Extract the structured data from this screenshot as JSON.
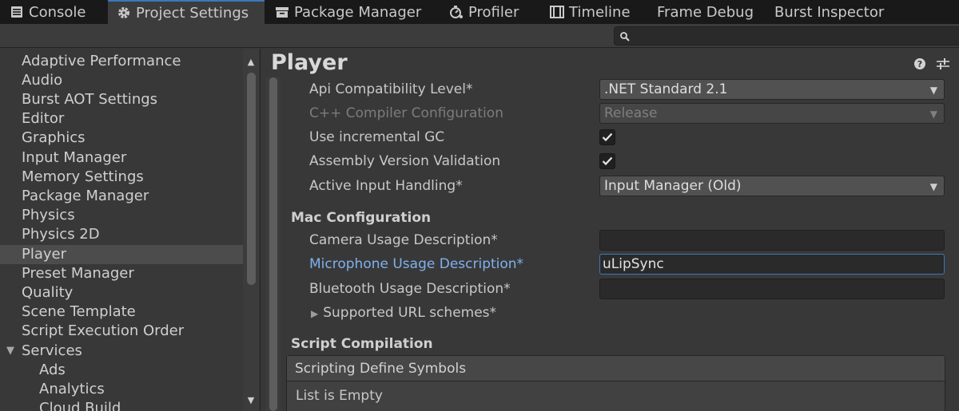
{
  "tabs": [
    {
      "label": "Console",
      "icon": "console-icon"
    },
    {
      "label": "Project Settings",
      "icon": "gear-icon"
    },
    {
      "label": "Package Manager",
      "icon": "package-icon"
    },
    {
      "label": "Profiler",
      "icon": "profiler-icon"
    },
    {
      "label": "Timeline",
      "icon": "timeline-icon"
    },
    {
      "label": "Frame Debug",
      "icon": ""
    },
    {
      "label": "Burst Inspector",
      "icon": ""
    }
  ],
  "active_tab": "Project Settings",
  "search": {
    "value": "",
    "placeholder": ""
  },
  "sidebar": {
    "items": [
      {
        "label": "Adaptive Performance"
      },
      {
        "label": "Audio"
      },
      {
        "label": "Burst AOT Settings"
      },
      {
        "label": "Editor"
      },
      {
        "label": "Graphics"
      },
      {
        "label": "Input Manager"
      },
      {
        "label": "Memory Settings"
      },
      {
        "label": "Package Manager"
      },
      {
        "label": "Physics"
      },
      {
        "label": "Physics 2D"
      },
      {
        "label": "Player"
      },
      {
        "label": "Preset Manager"
      },
      {
        "label": "Quality"
      },
      {
        "label": "Scene Template"
      },
      {
        "label": "Script Execution Order"
      },
      {
        "label": "Services"
      },
      {
        "label": "Ads"
      },
      {
        "label": "Analytics"
      },
      {
        "label": "Cloud Build"
      }
    ],
    "selected": "Player"
  },
  "main": {
    "title": "Player",
    "api_compat": {
      "label": "Api Compatibility Level*",
      "value": ".NET Standard 2.1"
    },
    "cpp_compiler": {
      "label": "C++ Compiler Configuration",
      "value": "Release"
    },
    "incremental_gc": {
      "label": "Use incremental GC",
      "checked": true
    },
    "assembly_validation": {
      "label": "Assembly Version Validation",
      "checked": true
    },
    "input_handling": {
      "label": "Active Input Handling*",
      "value": "Input Manager (Old)"
    },
    "mac_section": "Mac Configuration",
    "camera_desc": {
      "label": "Camera Usage Description*",
      "value": ""
    },
    "mic_desc": {
      "label": "Microphone Usage Description*",
      "value": "uLipSync"
    },
    "bluetooth_desc": {
      "label": "Bluetooth Usage Description*",
      "value": ""
    },
    "url_schemes": {
      "label": "Supported URL schemes*"
    },
    "script_section": "Script Compilation",
    "define_symbols": {
      "header": "Scripting Define Symbols",
      "empty_text": "List is Empty"
    }
  }
}
